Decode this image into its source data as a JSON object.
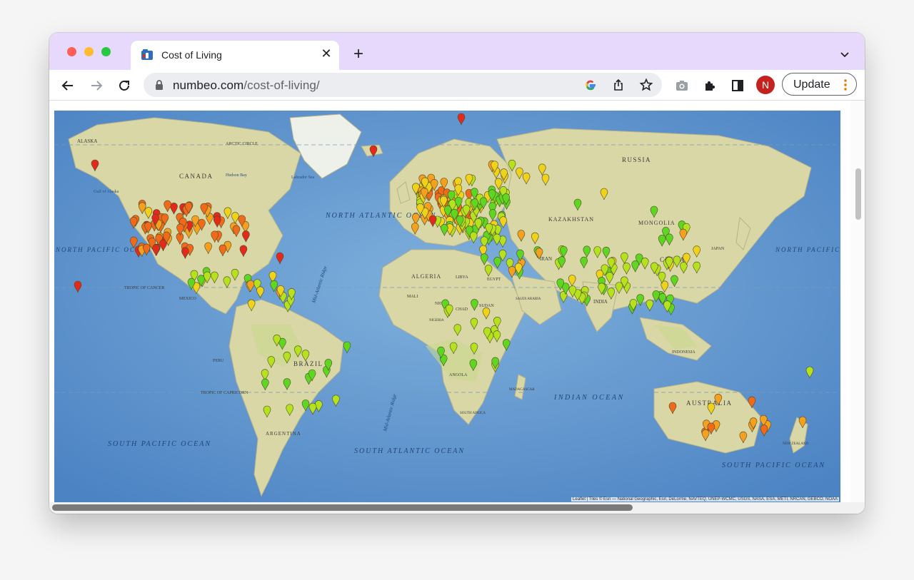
{
  "browser": {
    "tab_title": "Cost of Living",
    "url_host": "numbeo.com",
    "url_path": "/cost-of-living/",
    "profile_initial": "N",
    "update_label": "Update",
    "accent_color": "#e7d9fb"
  },
  "icons": {
    "favicon": "numbeo-icon",
    "close": "close-icon",
    "new_tab": "plus-icon",
    "tab_search": "chevron-down-icon",
    "back": "arrow-left-icon",
    "forward": "arrow-right-icon",
    "reload": "reload-icon",
    "lock": "lock-icon",
    "google": "google-icon",
    "share": "share-icon",
    "bookmark": "star-icon",
    "camera": "camera-icon",
    "extensions": "puzzle-icon",
    "side_panel": "side-panel-icon",
    "menu": "kebab-icon"
  },
  "map": {
    "labels": {
      "alaska": "ALASKA",
      "canada": "CANADA",
      "gulf_alaska": "Gulf of Alaska",
      "hudson_bay": "Hudson Bay",
      "labrador": "Labrador Sea",
      "north_atlantic": "NORTH ATLANTIC OCEAN",
      "russia": "RUSSIA",
      "kazakhstan": "KAZAKHSTAN",
      "mongolia": "MONGOLIA",
      "china": "CHINA",
      "north_pacific": "NORTH PACIFIC OCEAN",
      "north_pacific_w": "NORTH PACIFIC OCEAN",
      "algeria": "ALGERIA",
      "libya": "LIBYA",
      "egypt": "EGYPT",
      "brazil": "BRAZIL",
      "argentina": "ARGENTINA",
      "south_pacific": "SOUTH PACIFIC OCEAN",
      "south_atlantic": "SOUTH ATLANTIC OCEAN",
      "indian_ocean": "INDIAN OCEAN",
      "australia": "AUSTRALIA",
      "south_pacific_e": "SOUTH PACIFIC OCEAN",
      "tropic_cancer": "TROPIC OF CANCER",
      "tropic_capricorn": "TROPIC OF CAPRICORN",
      "arctic_circle": "ARCTIC CIRCLE",
      "new_zealand": "NEW ZEALAND",
      "india": "INDIA",
      "mexico": "MEXICO",
      "iran": "IRAN",
      "nigeria": "NIGERIA",
      "sudan": "SUDAN",
      "chad": "CHAD",
      "niger": "NIGER",
      "mali": "MALI",
      "angola": "ANGOLA",
      "madagascar": "MADAGASCAR",
      "peru": "PERU",
      "south_africa": "SOUTH AFRICA",
      "indonesia": "INDONESIA",
      "japan": "JAPAN",
      "saudi": "SAUDI ARABIA",
      "mid_atlantic": "Mid-Atlantic Ridge",
      "mid_atlantic_s": "Mid-Atlantic Ridge",
      "attribution": "Leaflet | Tiles © Esri — National Geographic, Esri, DeLorme, NAVTEQ, UNEP-WCMC, USGS, NASA, ESA, METI, NRCAN, GEBCO, NOAA"
    },
    "marker_colors": {
      "low": "#5fd61f",
      "lowmid": "#b6e21d",
      "mid": "#f0d21a",
      "midhigh": "#f5a01e",
      "high": "#f06a1a",
      "veryhigh": "#e2291b"
    }
  }
}
